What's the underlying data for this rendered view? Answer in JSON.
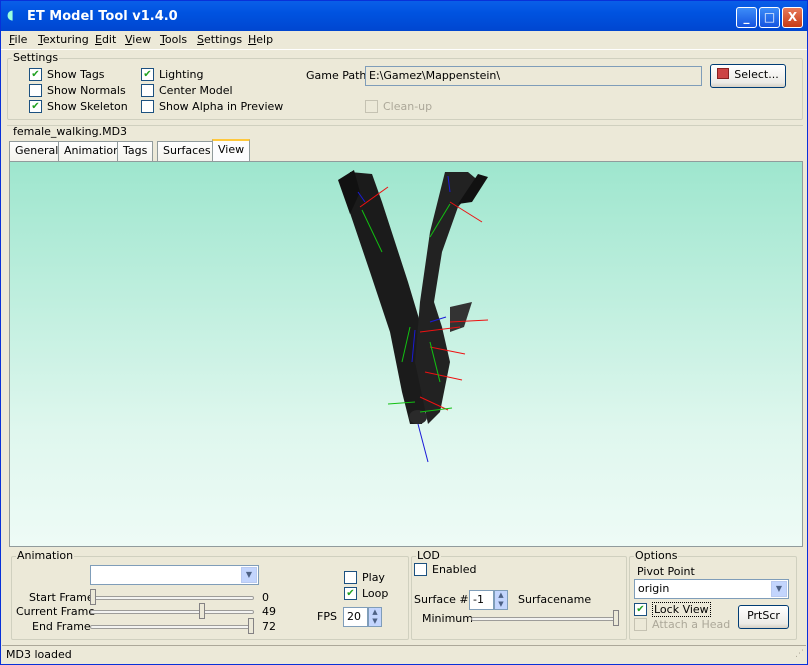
{
  "window": {
    "title": "ET Model Tool v1.4.0",
    "minimize": "_",
    "maximize": "□",
    "close": "X"
  },
  "menu": [
    "File",
    "Texturing",
    "Edit",
    "View",
    "Tools",
    "Settings",
    "Help"
  ],
  "settings": {
    "legend": "Settings",
    "show_tags": "Show Tags",
    "show_normals": "Show Normals",
    "show_skeleton": "Show Skeleton",
    "lighting": "Lighting",
    "center_model": "Center Model",
    "show_alpha": "Show Alpha in Preview",
    "game_path_label": "Game Path",
    "game_path_value": "E:\\Gamez\\Mappenstein\\",
    "select_button": "Select...",
    "cleanup": "Clean-up"
  },
  "model_name": "female_walking.MD3",
  "tabs": [
    "General",
    "Animation",
    "Tags",
    "Surfaces",
    "View"
  ],
  "animation": {
    "legend": "Animation",
    "selected": "",
    "start_frame_label": "Start Frame",
    "start_frame": "0",
    "current_frame_label": "Current Frame",
    "current_frame": "49",
    "end_frame_label": "End Frame",
    "end_frame": "72",
    "play": "Play",
    "loop": "Loop",
    "fps_label": "FPS",
    "fps": "20"
  },
  "lod": {
    "legend": "LOD",
    "enabled": "Enabled",
    "surface_label": "Surface #",
    "surface_value": "-1",
    "surfacename_label": "Surfacename",
    "minimum_label": "Minimum"
  },
  "options": {
    "legend": "Options",
    "pivot_label": "Pivot Point",
    "pivot_value": "origin",
    "lock_view": "Lock View",
    "attach_head": "Attach a Head",
    "prtscr": "PrtScr"
  },
  "status": "MD3 loaded",
  "colors": {
    "accent": "#0054E3",
    "viewport_top": "#9EE6CE",
    "viewport_bottom": "#EEFBF6"
  }
}
